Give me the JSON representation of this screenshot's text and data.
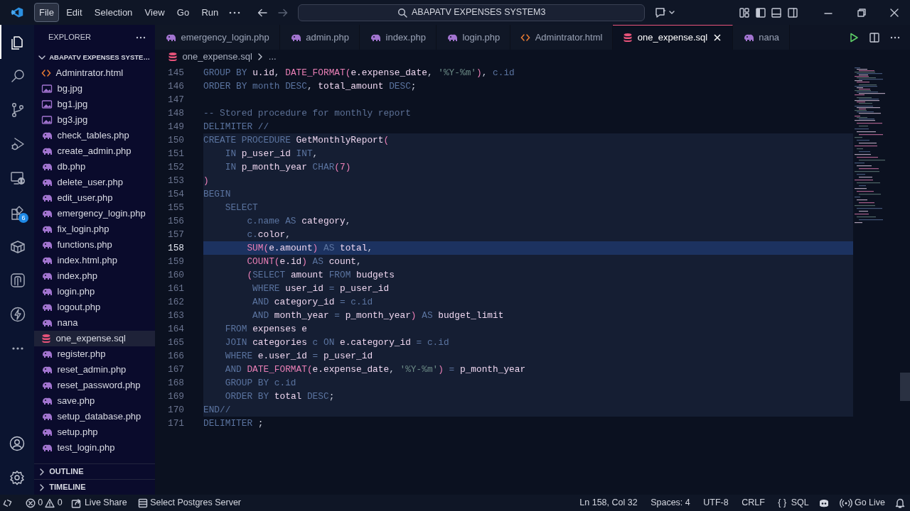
{
  "menu": [
    {
      "label": "File",
      "selected": true
    },
    {
      "label": "Edit",
      "selected": false
    },
    {
      "label": "Selection",
      "selected": false
    },
    {
      "label": "View",
      "selected": false
    },
    {
      "label": "Go",
      "selected": false
    },
    {
      "label": "Run",
      "selected": false
    }
  ],
  "search": {
    "value": "ABAPATV EXPENSES SYSTEM3"
  },
  "activity_bar": [
    {
      "kind": "explorer",
      "selected": true
    },
    {
      "kind": "search",
      "selected": false
    },
    {
      "kind": "source-control",
      "selected": false
    },
    {
      "kind": "debug",
      "selected": false
    },
    {
      "kind": "remote",
      "selected": false
    },
    {
      "kind": "extensions",
      "selected": false,
      "badge": "6"
    },
    {
      "kind": "container",
      "selected": false
    },
    {
      "kind": "database",
      "selected": false
    },
    {
      "kind": "lightning",
      "selected": false
    },
    {
      "kind": "more",
      "selected": false
    }
  ],
  "sidebar": {
    "title": "EXPLORER",
    "folder": "ABAPATV EXPENSES SYSTE…",
    "files": [
      {
        "name": "Admintrator.html",
        "kind": "html",
        "selected": false
      },
      {
        "name": "bg.jpg",
        "kind": "image",
        "selected": false
      },
      {
        "name": "bg1.jpg",
        "kind": "image",
        "selected": false
      },
      {
        "name": "bg3.jpg",
        "kind": "image",
        "selected": false
      },
      {
        "name": "check_tables.php",
        "kind": "php",
        "selected": false
      },
      {
        "name": "create_admin.php",
        "kind": "php",
        "selected": false
      },
      {
        "name": "db.php",
        "kind": "php",
        "selected": false
      },
      {
        "name": "delete_user.php",
        "kind": "php",
        "selected": false
      },
      {
        "name": "edit_user.php",
        "kind": "php",
        "selected": false
      },
      {
        "name": "emergency_login.php",
        "kind": "php",
        "selected": false
      },
      {
        "name": "fix_login.php",
        "kind": "php",
        "selected": false
      },
      {
        "name": "functions.php",
        "kind": "php",
        "selected": false
      },
      {
        "name": "index.html.php",
        "kind": "php",
        "selected": false
      },
      {
        "name": "index.php",
        "kind": "php",
        "selected": false
      },
      {
        "name": "login.php",
        "kind": "php",
        "selected": false
      },
      {
        "name": "logout.php",
        "kind": "php",
        "selected": false
      },
      {
        "name": "nana",
        "kind": "php",
        "selected": false
      },
      {
        "name": "one_expense.sql",
        "kind": "sql",
        "selected": true
      },
      {
        "name": "register.php",
        "kind": "php",
        "selected": false
      },
      {
        "name": "reset_admin.php",
        "kind": "php",
        "selected": false
      },
      {
        "name": "reset_password.php",
        "kind": "php",
        "selected": false
      },
      {
        "name": "save.php",
        "kind": "php",
        "selected": false
      },
      {
        "name": "setup_database.php",
        "kind": "php",
        "selected": false
      },
      {
        "name": "setup.php",
        "kind": "php",
        "selected": false
      },
      {
        "name": "test_login.php",
        "kind": "php",
        "selected": false
      }
    ],
    "sections": [
      {
        "label": "OUTLINE",
        "expanded": false
      },
      {
        "label": "TIMELINE",
        "expanded": false
      }
    ]
  },
  "tabs": [
    {
      "label": "emergency_login.php",
      "kind": "php",
      "selected": false
    },
    {
      "label": "admin.php",
      "kind": "php",
      "selected": false
    },
    {
      "label": "index.php",
      "kind": "php",
      "selected": false
    },
    {
      "label": "login.php",
      "kind": "php",
      "selected": false
    },
    {
      "label": "Admintrator.html",
      "kind": "html",
      "selected": false
    },
    {
      "label": "one_expense.sql",
      "kind": "sql",
      "selected": true
    },
    {
      "label": "nana",
      "kind": "php",
      "selected": false
    }
  ],
  "breadcrumb": [
    "one_expense.sql",
    "..."
  ],
  "code": [
    {
      "number": "145",
      "current": false,
      "scope": false,
      "tokens": [
        {
          "text": "GROUP BY ",
          "kind": "kw"
        },
        {
          "text": "u.id",
          "kind": "id"
        },
        {
          "text": ", ",
          "kind": "punct"
        },
        {
          "text": "DATE_FORMAT",
          "kind": "fn"
        },
        {
          "text": "(",
          "kind": "paren"
        },
        {
          "text": "e.expense_date",
          "kind": "id"
        },
        {
          "text": ", ",
          "kind": "punct"
        },
        {
          "text": "'%Y-%m'",
          "kind": "str"
        },
        {
          "text": ")",
          "kind": "paren"
        },
        {
          "text": ", ",
          "kind": "punct"
        },
        {
          "text": "c.id",
          "kind": "kw"
        }
      ]
    },
    {
      "number": "146",
      "current": false,
      "scope": false,
      "tokens": [
        {
          "text": "ORDER BY month DESC",
          "kind": "kw"
        },
        {
          "text": ", ",
          "kind": "punct"
        },
        {
          "text": "total_amount ",
          "kind": "id"
        },
        {
          "text": "DESC",
          "kind": "kw"
        },
        {
          "text": ";",
          "kind": "punct"
        }
      ]
    },
    {
      "number": "147",
      "current": false,
      "scope": false
    },
    {
      "number": "148",
      "current": false,
      "scope": false,
      "tokens": [
        {
          "text": "-- Stored procedure for monthly report",
          "kind": "comment"
        }
      ]
    },
    {
      "number": "149",
      "current": false,
      "scope": false,
      "tokens": [
        {
          "text": "DELIMITER //",
          "kind": "kw"
        }
      ]
    },
    {
      "number": "150",
      "current": false,
      "scope": true,
      "tokens": [
        {
          "text": "CREATE PROCEDURE ",
          "kind": "kw"
        },
        {
          "text": "GetMonthlyReport",
          "kind": "id"
        },
        {
          "text": "(",
          "kind": "paren"
        }
      ]
    },
    {
      "number": "151",
      "current": false,
      "scope": true,
      "tokens": [
        {
          "text": "    IN ",
          "kind": "kw"
        },
        {
          "text": "p_user_id ",
          "kind": "id"
        },
        {
          "text": "INT",
          "kind": "kw"
        },
        {
          "text": ",",
          "kind": "punct"
        }
      ]
    },
    {
      "number": "152",
      "current": false,
      "scope": true,
      "tokens": [
        {
          "text": "    IN ",
          "kind": "kw"
        },
        {
          "text": "p_month_year ",
          "kind": "id"
        },
        {
          "text": "CHAR",
          "kind": "kw"
        },
        {
          "text": "(7)",
          "kind": "paren"
        }
      ]
    },
    {
      "number": "153",
      "current": false,
      "scope": true,
      "tokens": [
        {
          "text": ")",
          "kind": "paren"
        }
      ]
    },
    {
      "number": "154",
      "current": false,
      "scope": true,
      "tokens": [
        {
          "text": "BEGIN",
          "kind": "kw"
        }
      ]
    },
    {
      "number": "155",
      "current": false,
      "scope": true,
      "tokens": [
        {
          "text": "    SELECT",
          "kind": "kw"
        }
      ]
    },
    {
      "number": "156",
      "current": false,
      "scope": true,
      "tokens": [
        {
          "text": "        c.name AS ",
          "kind": "kw"
        },
        {
          "text": "category",
          "kind": "id"
        },
        {
          "text": ",",
          "kind": "punct"
        }
      ]
    },
    {
      "number": "157",
      "current": false,
      "scope": true,
      "tokens": [
        {
          "text": "        c.",
          "kind": "kw"
        },
        {
          "text": "color",
          "kind": "id"
        },
        {
          "text": ",",
          "kind": "punct"
        }
      ]
    },
    {
      "number": "158",
      "current": true,
      "scope": true,
      "tokens": [
        {
          "text": "        SUM",
          "kind": "fn"
        },
        {
          "text": "(",
          "kind": "paren"
        },
        {
          "text": "e.amount",
          "kind": "id"
        },
        {
          "text": ") ",
          "kind": "paren"
        },
        {
          "text": "AS ",
          "kind": "kw"
        },
        {
          "text": "total",
          "kind": "id"
        },
        {
          "text": ",",
          "kind": "punct"
        }
      ]
    },
    {
      "number": "159",
      "current": false,
      "scope": true,
      "tokens": [
        {
          "text": "        COUNT",
          "kind": "fn"
        },
        {
          "text": "(",
          "kind": "paren"
        },
        {
          "text": "e.id",
          "kind": "id"
        },
        {
          "text": ") ",
          "kind": "paren"
        },
        {
          "text": "AS ",
          "kind": "kw"
        },
        {
          "text": "count",
          "kind": "id"
        },
        {
          "text": ",",
          "kind": "punct"
        }
      ]
    },
    {
      "number": "160",
      "current": false,
      "scope": true,
      "tokens": [
        {
          "text": "        (",
          "kind": "paren"
        },
        {
          "text": "SELECT ",
          "kind": "kw"
        },
        {
          "text": "amount ",
          "kind": "id"
        },
        {
          "text": "FROM ",
          "kind": "kw"
        },
        {
          "text": "budgets",
          "kind": "id"
        }
      ]
    },
    {
      "number": "161",
      "current": false,
      "scope": true,
      "tokens": [
        {
          "text": "         WHERE ",
          "kind": "kw"
        },
        {
          "text": "user_id ",
          "kind": "id"
        },
        {
          "text": "= ",
          "kind": "kw"
        },
        {
          "text": "p_user_id",
          "kind": "id"
        }
      ]
    },
    {
      "number": "162",
      "current": false,
      "scope": true,
      "tokens": [
        {
          "text": "         AND ",
          "kind": "kw"
        },
        {
          "text": "category_id ",
          "kind": "id"
        },
        {
          "text": "= c.id",
          "kind": "kw"
        }
      ]
    },
    {
      "number": "163",
      "current": false,
      "scope": true,
      "tokens": [
        {
          "text": "         AND ",
          "kind": "kw"
        },
        {
          "text": "month_year ",
          "kind": "id"
        },
        {
          "text": "= ",
          "kind": "kw"
        },
        {
          "text": "p_month_year",
          "kind": "id"
        },
        {
          "text": ") ",
          "kind": "paren"
        },
        {
          "text": "AS ",
          "kind": "kw"
        },
        {
          "text": "budget_limit",
          "kind": "id"
        }
      ]
    },
    {
      "number": "164",
      "current": false,
      "scope": true,
      "tokens": [
        {
          "text": "    FROM ",
          "kind": "kw"
        },
        {
          "text": "expenses e",
          "kind": "id"
        }
      ]
    },
    {
      "number": "165",
      "current": false,
      "scope": true,
      "tokens": [
        {
          "text": "    JOIN ",
          "kind": "kw"
        },
        {
          "text": "categories ",
          "kind": "id"
        },
        {
          "text": "c ON ",
          "kind": "kw"
        },
        {
          "text": "e.category_id ",
          "kind": "id"
        },
        {
          "text": "= c.id",
          "kind": "kw"
        }
      ]
    },
    {
      "number": "166",
      "current": false,
      "scope": true,
      "tokens": [
        {
          "text": "    WHERE ",
          "kind": "kw"
        },
        {
          "text": "e.user_id ",
          "kind": "id"
        },
        {
          "text": "= ",
          "kind": "kw"
        },
        {
          "text": "p_user_id",
          "kind": "id"
        }
      ]
    },
    {
      "number": "167",
      "current": false,
      "scope": true,
      "tokens": [
        {
          "text": "    AND ",
          "kind": "kw"
        },
        {
          "text": "DATE_FORMAT",
          "kind": "fn"
        },
        {
          "text": "(",
          "kind": "paren"
        },
        {
          "text": "e.expense_date",
          "kind": "id"
        },
        {
          "text": ", ",
          "kind": "punct"
        },
        {
          "text": "'%Y-%m'",
          "kind": "str"
        },
        {
          "text": ") ",
          "kind": "paren"
        },
        {
          "text": "= ",
          "kind": "kw"
        },
        {
          "text": "p_month_year",
          "kind": "id"
        }
      ]
    },
    {
      "number": "168",
      "current": false,
      "scope": true,
      "tokens": [
        {
          "text": "    GROUP BY c.id",
          "kind": "kw"
        }
      ]
    },
    {
      "number": "169",
      "current": false,
      "scope": true,
      "tokens": [
        {
          "text": "    ORDER BY ",
          "kind": "kw"
        },
        {
          "text": "total ",
          "kind": "id"
        },
        {
          "text": "DESC",
          "kind": "kw"
        },
        {
          "text": ";",
          "kind": "punct"
        }
      ]
    },
    {
      "number": "170",
      "current": false,
      "scope": true,
      "tokens": [
        {
          "text": "END//",
          "kind": "kw"
        }
      ]
    },
    {
      "number": "171",
      "current": false,
      "scope": false,
      "tokens": [
        {
          "text": "DELIMITER ",
          "kind": "kw"
        },
        {
          "text": ";",
          "kind": "punct"
        }
      ]
    }
  ],
  "status_bar": {
    "errors": "0",
    "warnings": "0",
    "live_share": "Live Share",
    "server": "Select Postgres Server",
    "position": "Ln 158, Col 32",
    "spaces": "Spaces: 4",
    "encoding": "UTF-8",
    "eol": "CRLF",
    "braces": "{ }",
    "language": "SQL",
    "go_live": "Go Live"
  }
}
